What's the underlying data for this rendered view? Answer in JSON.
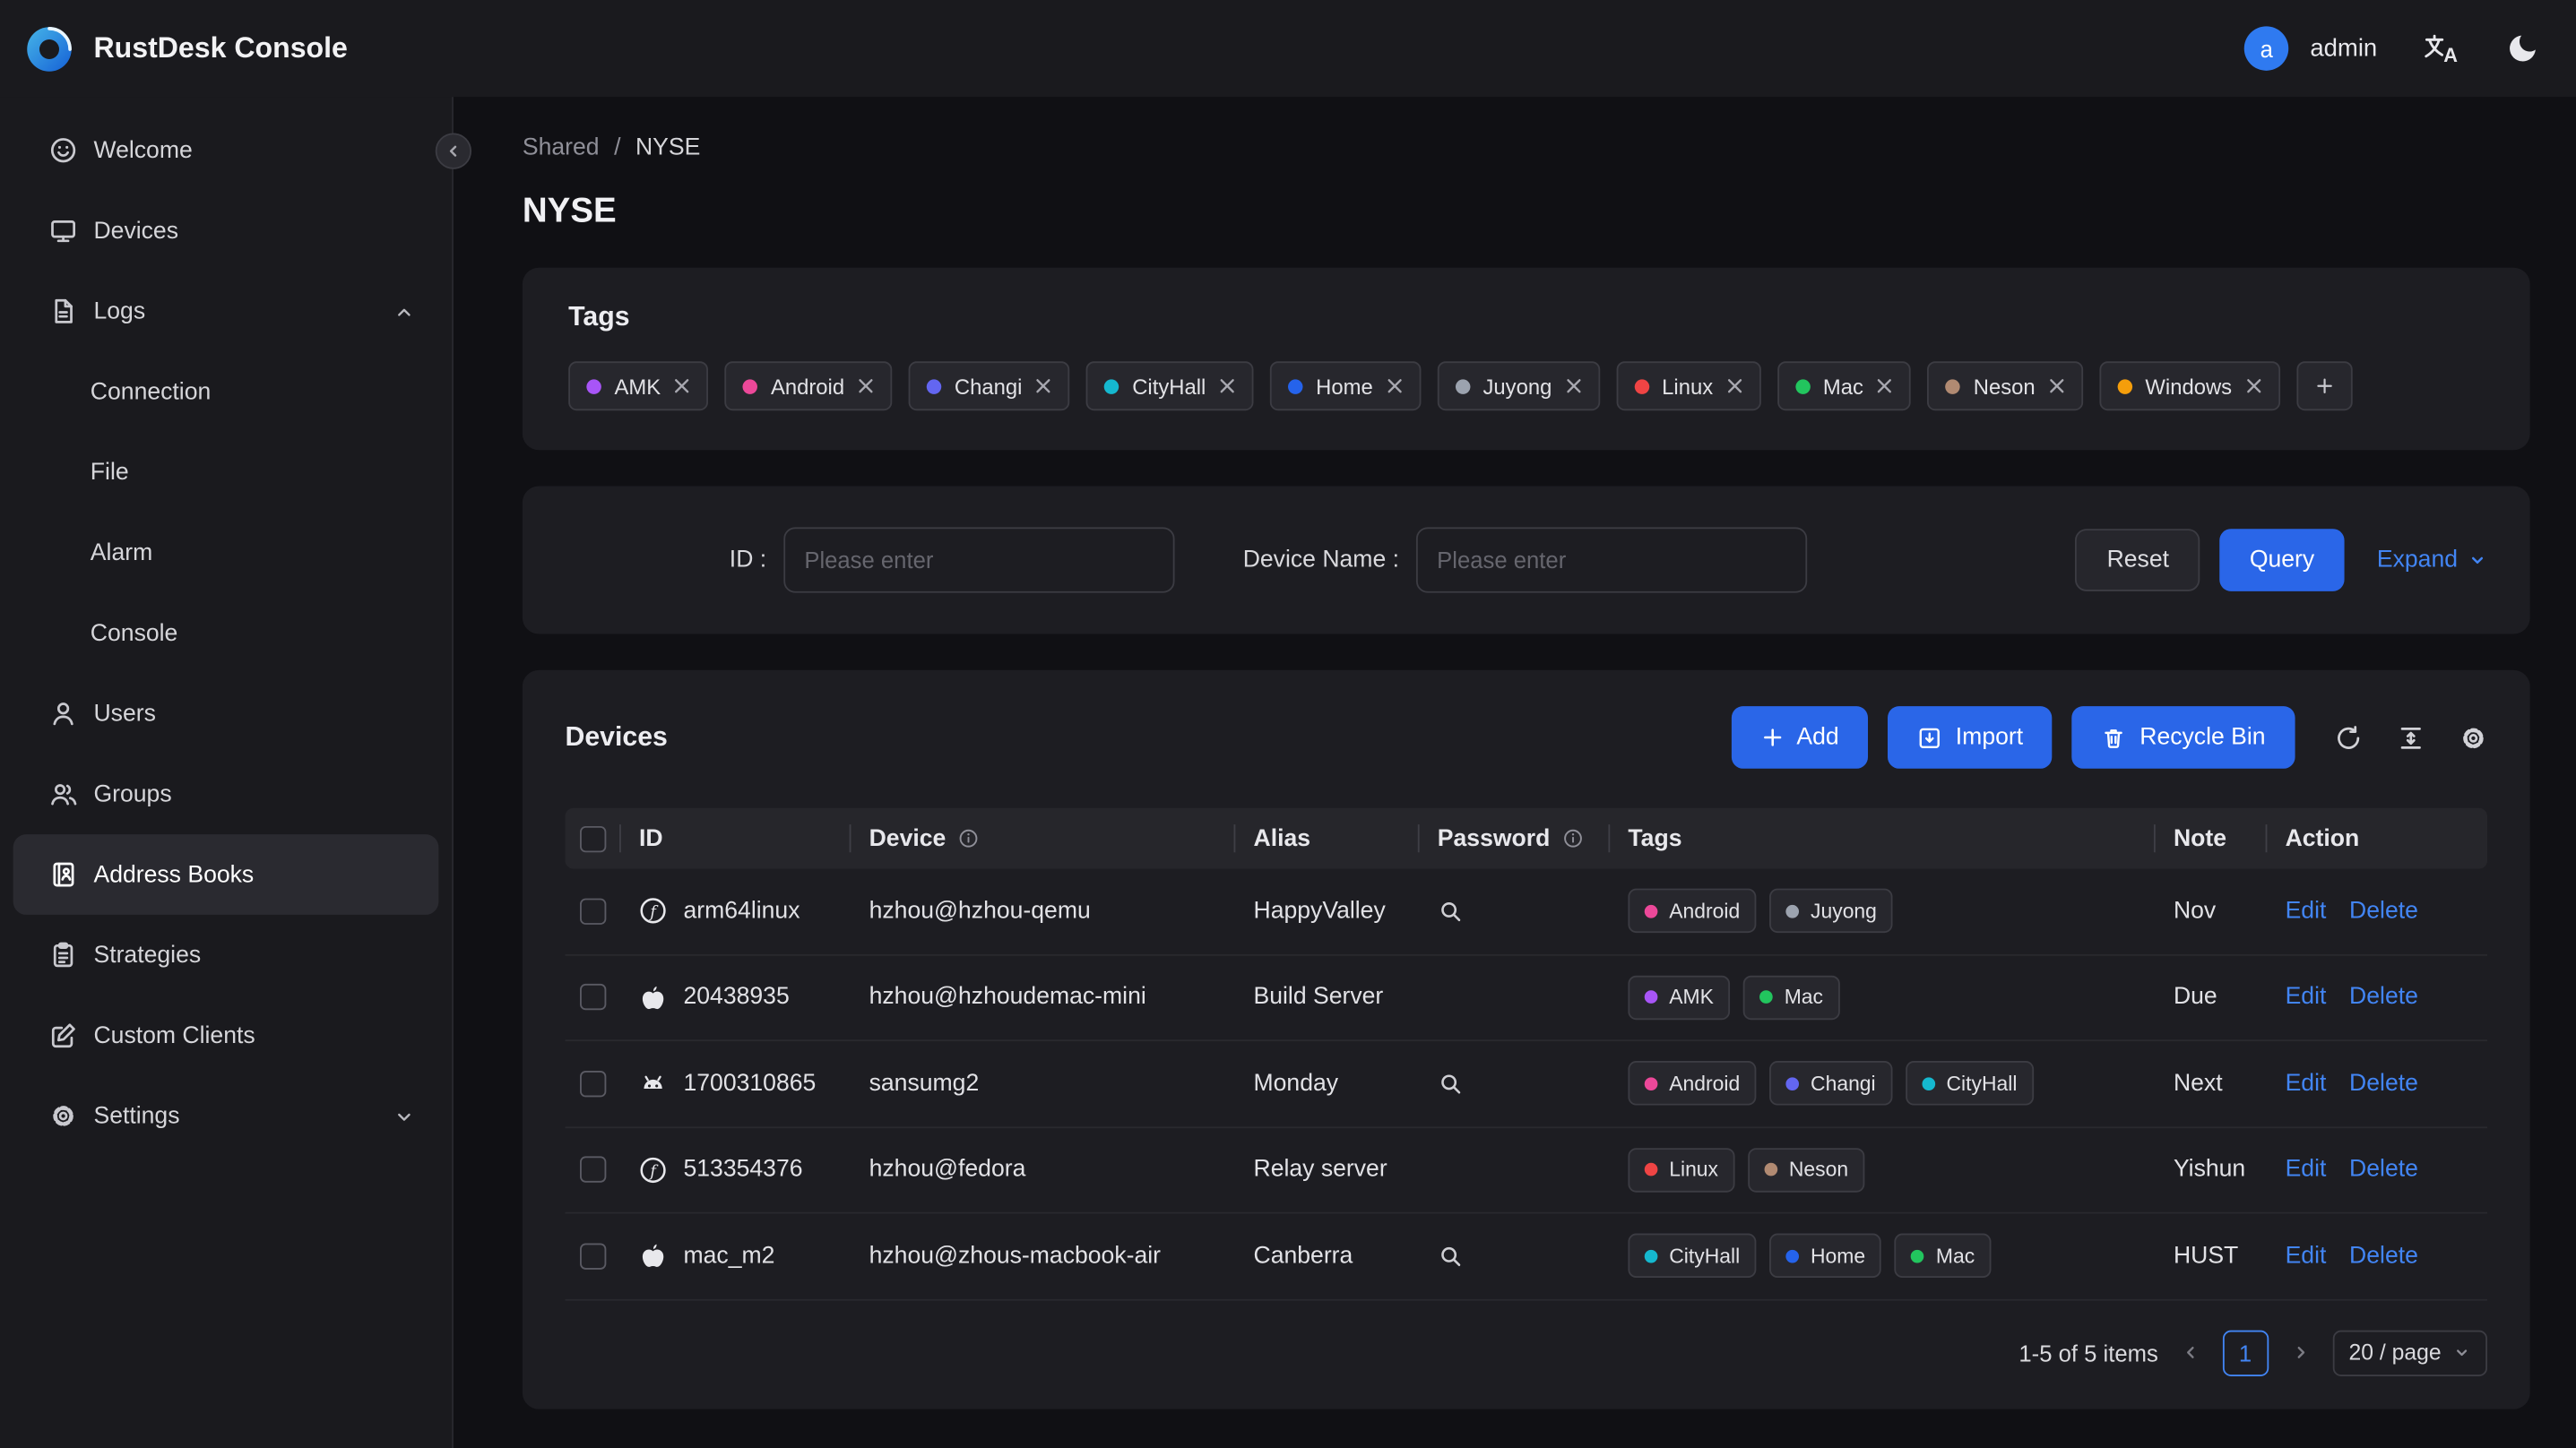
{
  "colors": {
    "accent": "#2a66e8",
    "link": "#4285f4",
    "avatar_bg": "#2f7af0"
  },
  "header": {
    "app_title": "RustDesk Console",
    "user_initial": "a",
    "user_name": "admin"
  },
  "sidebar": {
    "welcome": "Welcome",
    "devices": "Devices",
    "logs": "Logs",
    "connection": "Connection",
    "file": "File",
    "alarm": "Alarm",
    "console": "Console",
    "users": "Users",
    "groups": "Groups",
    "address_books": "Address Books",
    "strategies": "Strategies",
    "custom_clients": "Custom Clients",
    "settings": "Settings"
  },
  "breadcrumb": {
    "parent": "Shared",
    "separator": "/",
    "current": "NYSE"
  },
  "page_title": "NYSE",
  "tags_card": {
    "title": "Tags",
    "chips": [
      {
        "label": "AMK",
        "color": "#a855f7"
      },
      {
        "label": "Android",
        "color": "#ec4899"
      },
      {
        "label": "Changi",
        "color": "#6366f1"
      },
      {
        "label": "CityHall",
        "color": "#15b8cf"
      },
      {
        "label": "Home",
        "color": "#2563eb"
      },
      {
        "label": "Juyong",
        "color": "#9ca3af"
      },
      {
        "label": "Linux",
        "color": "#ef4444"
      },
      {
        "label": "Mac",
        "color": "#22c55e"
      },
      {
        "label": "Neson",
        "color": "#b18a72"
      },
      {
        "label": "Windows",
        "color": "#f59e0b"
      }
    ]
  },
  "filter": {
    "id_label": "ID :",
    "device_name_label": "Device Name :",
    "placeholder": "Please enter",
    "reset_label": "Reset",
    "query_label": "Query",
    "expand_label": "Expand"
  },
  "devices_card": {
    "title": "Devices",
    "add_label": "Add",
    "import_label": "Import",
    "recycle_bin_label": "Recycle Bin",
    "table": {
      "headers": {
        "id": "ID",
        "device": "Device",
        "alias": "Alias",
        "password": "Password",
        "tags": "Tags",
        "note": "Note",
        "action": "Action"
      },
      "edit_label": "Edit",
      "delete_label": "Delete",
      "rows": [
        {
          "os": "linux",
          "id": "arm64linux",
          "device": "hzhou@hzhou-qemu",
          "alias": "HappyValley",
          "has_password": true,
          "note": "Nov",
          "tags": [
            {
              "label": "Android",
              "color": "#ec4899"
            },
            {
              "label": "Juyong",
              "color": "#9ca3af"
            }
          ]
        },
        {
          "os": "apple",
          "id": "20438935",
          "device": "hzhou@hzhoudemac-mini",
          "alias": "Build Server",
          "has_password": false,
          "note": "Due",
          "tags": [
            {
              "label": "AMK",
              "color": "#a855f7"
            },
            {
              "label": "Mac",
              "color": "#22c55e"
            }
          ]
        },
        {
          "os": "android",
          "id": "1700310865",
          "device": "sansumg2",
          "alias": "Monday",
          "has_password": true,
          "note": "Next",
          "tags": [
            {
              "label": "Android",
              "color": "#ec4899"
            },
            {
              "label": "Changi",
              "color": "#6366f1"
            },
            {
              "label": "CityHall",
              "color": "#15b8cf"
            }
          ]
        },
        {
          "os": "linux",
          "id": "513354376",
          "device": "hzhou@fedora",
          "alias": "Relay server",
          "has_password": false,
          "note": "Yishun",
          "tags": [
            {
              "label": "Linux",
              "color": "#ef4444"
            },
            {
              "label": "Neson",
              "color": "#b18a72"
            }
          ]
        },
        {
          "os": "apple",
          "id": "mac_m2",
          "device": "hzhou@zhous-macbook-air",
          "alias": "Canberra",
          "has_password": true,
          "note": "HUST",
          "tags": [
            {
              "label": "CityHall",
              "color": "#15b8cf"
            },
            {
              "label": "Home",
              "color": "#2563eb"
            },
            {
              "label": "Mac",
              "color": "#22c55e"
            }
          ]
        }
      ]
    },
    "pagination": {
      "summary": "1-5 of 5 items",
      "page": "1",
      "page_size": "20 / page"
    }
  },
  "icons": [
    "rustdesk-logo",
    "avatar",
    "translate",
    "dark-mode-moon",
    "smiley",
    "monitor",
    "file-text",
    "person",
    "people",
    "address-book",
    "clipboard",
    "edit-square",
    "gear",
    "chevron",
    "collapse-circle",
    "plus",
    "import-box",
    "trash",
    "refresh",
    "row-height",
    "search",
    "info",
    "close-x",
    "apple",
    "android",
    "linux"
  ]
}
